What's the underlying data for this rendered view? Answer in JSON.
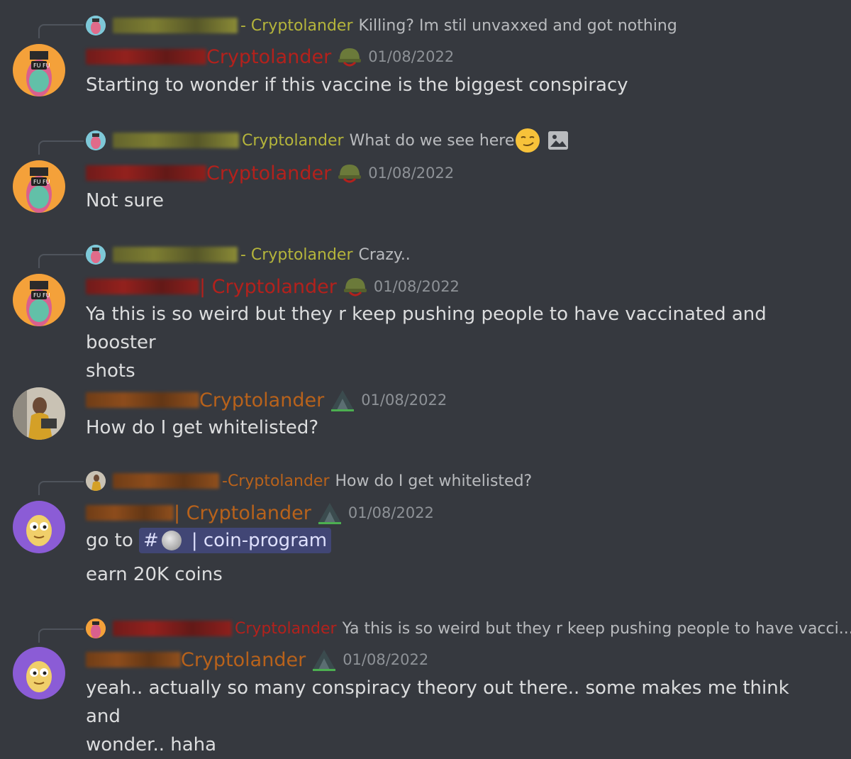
{
  "colors": {
    "background": "#36393f",
    "text": "#dcddde",
    "muted": "#8e9297",
    "role_olive": "#b5b53b",
    "role_red": "#b3211c",
    "role_orange": "#b8621b",
    "mention_bg": "#414675"
  },
  "messages": [
    {
      "reply": {
        "role": "- Cryptolander",
        "text": "Killing? Im stil unvaxxed and got nothing"
      },
      "role": "Cryptolander",
      "badge": "helmet-icon",
      "timestamp": "01/08/2022",
      "lines": [
        "Starting to wonder if this vaccine is the biggest conspiracy"
      ]
    },
    {
      "reply": {
        "role": "Cryptolander",
        "text": "What do we see here"
      },
      "role": "Cryptolander",
      "badge": "helmet-icon",
      "timestamp": "01/08/2022",
      "lines": [
        "Not sure"
      ]
    },
    {
      "reply": {
        "role": "- Cryptolander",
        "text": "Crazy.."
      },
      "role": "| Cryptolander",
      "badge": "helmet-icon",
      "timestamp": "01/08/2022",
      "lines": [
        "Ya this is so weird but they r keep pushing people to have vaccinated and booster",
        "shots"
      ]
    },
    {
      "role": "Cryptolander",
      "badge": "mountain-icon",
      "timestamp": "01/08/2022",
      "lines": [
        "How do I get whitelisted?"
      ]
    },
    {
      "reply": {
        "role": "-Cryptolander",
        "text": "How do I get whitelisted?"
      },
      "role": "| Cryptolander",
      "badge": "mountain-icon",
      "timestamp": "01/08/2022",
      "prefix": "go to",
      "mention_hash": "#",
      "mention_label": "| coin-program",
      "lines": [
        "earn 20K coins"
      ]
    },
    {
      "reply": {
        "role": "Cryptolander",
        "text": "Ya this is so weird but they r keep pushing people to have vacci..."
      },
      "role": "Cryptolander",
      "badge": "mountain-icon",
      "timestamp": "01/08/2022",
      "lines": [
        "yeah.. actually so many conspiracy theory out there.. some makes me think and",
        "wonder.. haha"
      ]
    }
  ]
}
